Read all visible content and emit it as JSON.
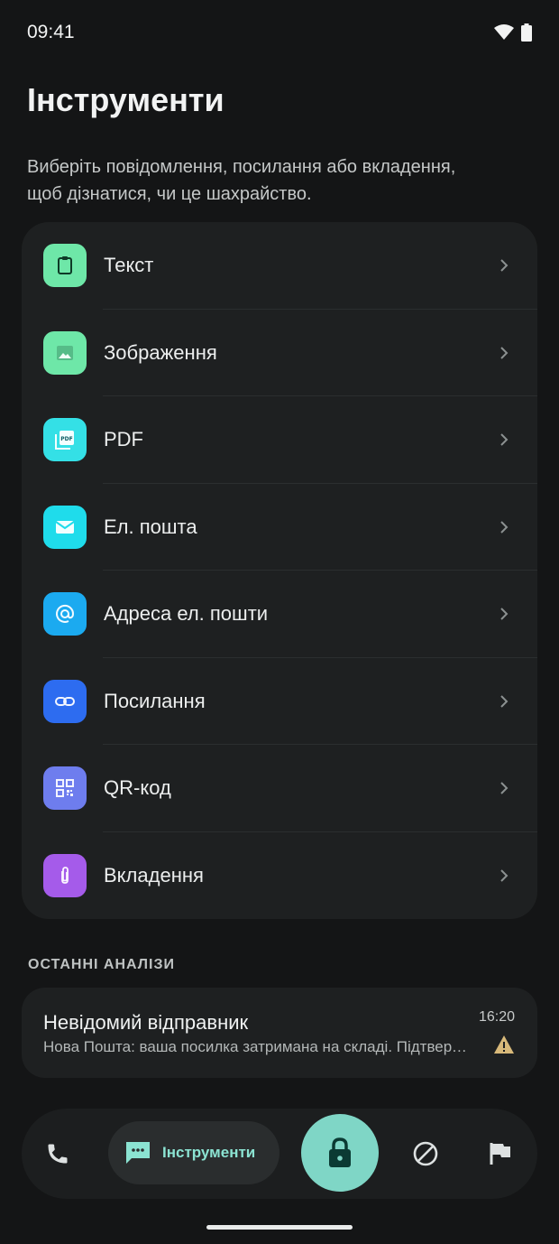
{
  "status_bar": {
    "time": "09:41"
  },
  "header": {
    "title": "Інструменти",
    "subtitle": "Виберіть повідомлення, посилання або вкладення,\nщоб дізнатися, чи це шахрайство."
  },
  "tools": [
    {
      "label": "Текст",
      "icon": "clipboard-icon",
      "color": "#6EE7A8"
    },
    {
      "label": "Зображення",
      "icon": "image-icon",
      "color": "#6EE7A8"
    },
    {
      "label": "PDF",
      "icon": "pdf-icon",
      "color": "#34E0E6"
    },
    {
      "label": "Ел. пошта",
      "icon": "mail-icon",
      "color": "#1FDCEB"
    },
    {
      "label": "Адреса ел. пошти",
      "icon": "at-icon",
      "color": "#1BAAF0"
    },
    {
      "label": "Посилання",
      "icon": "link-icon",
      "color": "#2D6CF0"
    },
    {
      "label": "QR-код",
      "icon": "qr-icon",
      "color": "#6E7DEE"
    },
    {
      "label": "Вкладення",
      "icon": "paperclip-icon",
      "color": "#A55BEA"
    }
  ],
  "recent": {
    "section_title": "ОСТАННІ АНАЛІЗИ",
    "items": [
      {
        "sender": "Невідомий відправник",
        "preview": "Нова Пошта: ваша посилка затримана на складі. Підтвердіть доставку",
        "time": "16:20",
        "status_icon": "warning-icon",
        "status_color": "#D8B97A"
      }
    ]
  },
  "bottom_nav": {
    "tools_label": "Інструменти",
    "accent": "#7FD6C6"
  }
}
